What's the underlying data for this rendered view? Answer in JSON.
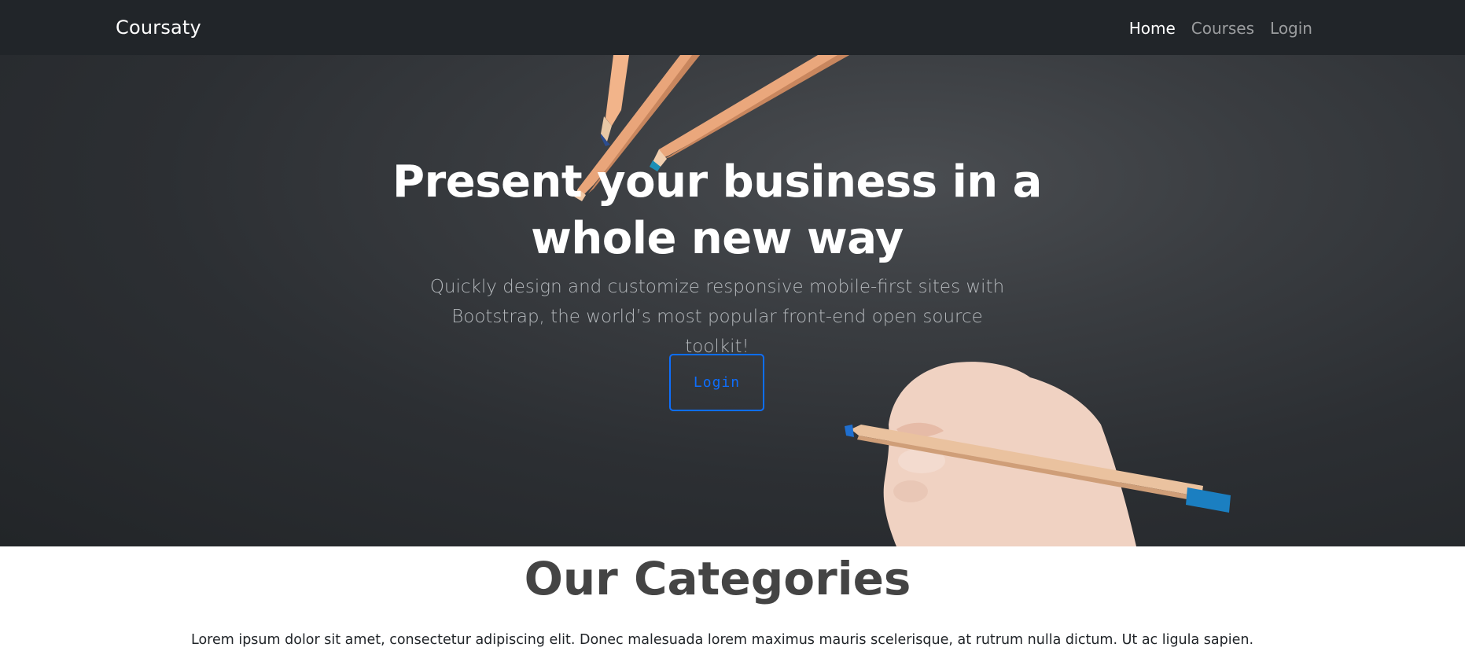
{
  "navbar": {
    "brand": "Coursaty",
    "links": [
      {
        "label": "Home",
        "active": true
      },
      {
        "label": "Courses",
        "active": false
      },
      {
        "label": "Login",
        "active": false
      }
    ]
  },
  "hero": {
    "title_line1": "Present your business in a",
    "title_line2": "whole new way",
    "subtitle_line1": "Quickly design and customize responsive mobile-first sites with",
    "subtitle_line2": "Bootstrap, the world’s most popular front-end open source toolkit!",
    "button_label": "Login"
  },
  "categories": {
    "title": "Our Categories",
    "text": "Lorem ipsum dolor sit amet, consectetur adipiscing elit. Donec malesuada lorem maximus mauris scelerisque, at rutrum nulla dictum. Ut ac ligula sapien."
  },
  "colors": {
    "navbar_bg": "#212529",
    "accent": "#0d6efd",
    "heading": "#444444"
  },
  "icons": {
    "hero_art": "pencils-and-hand-illustration"
  }
}
